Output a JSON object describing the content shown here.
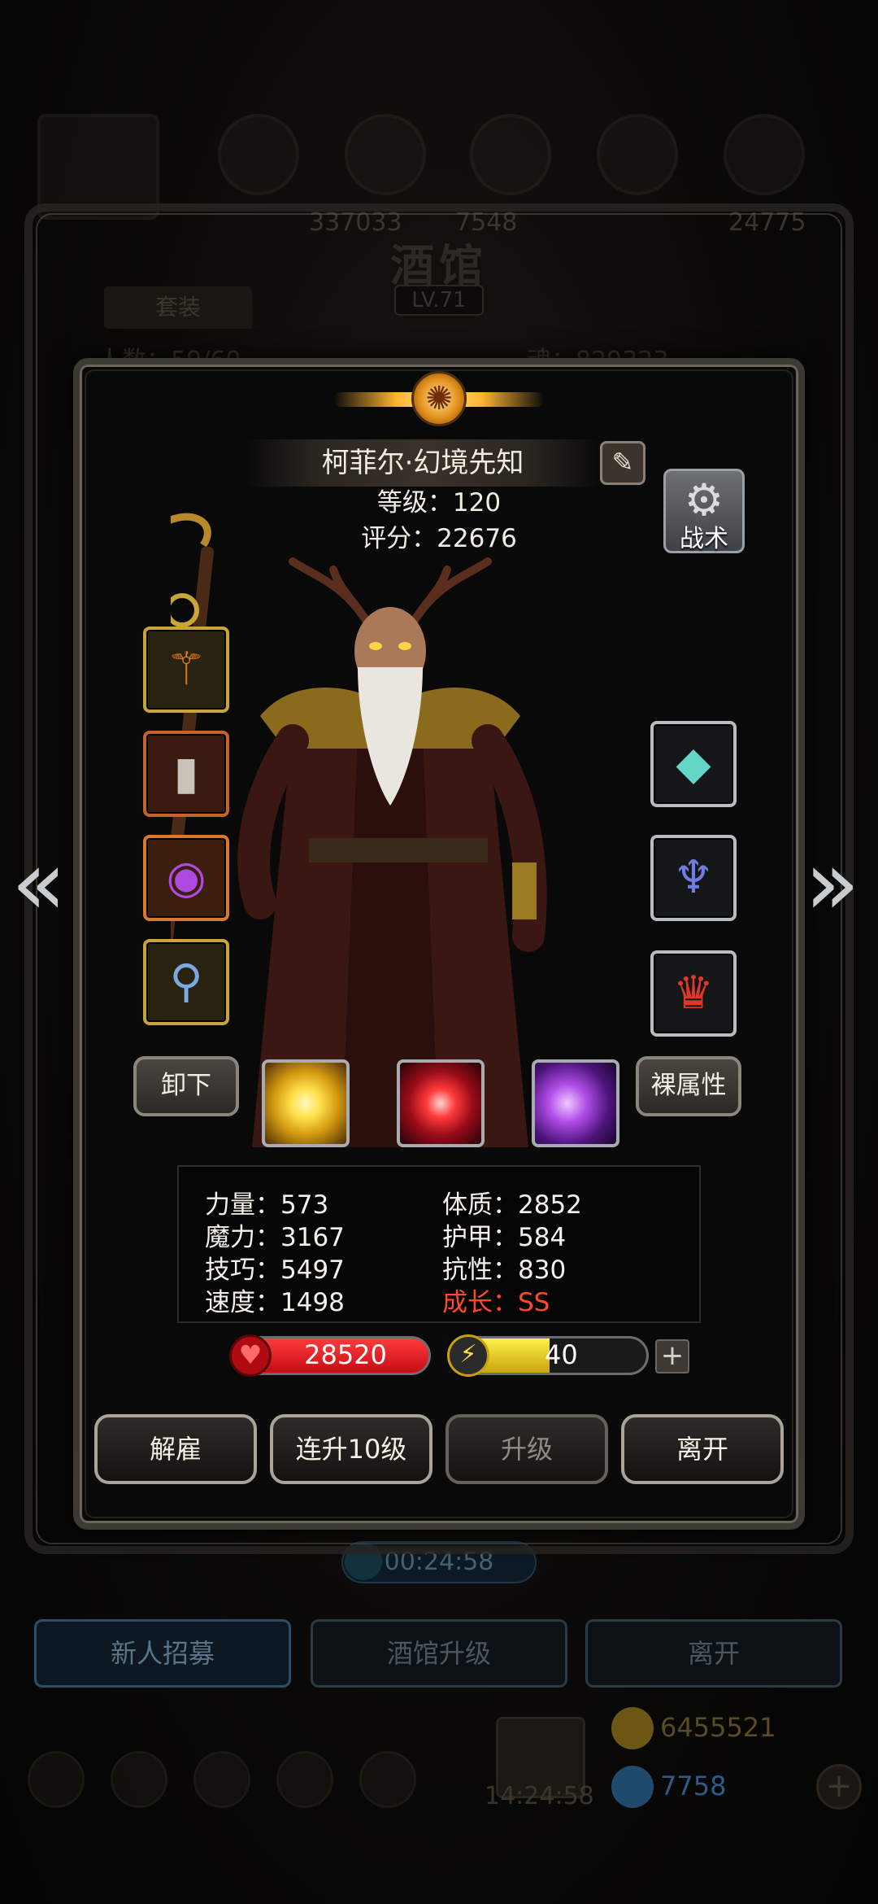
{
  "background": {
    "resource_values": [
      "337033",
      "7548",
      "24775"
    ],
    "title": "酒馆",
    "level": "LV.71",
    "tab_label": "套装",
    "capacity_text": "人数：59/60",
    "soul_text": "魂：829323",
    "timer": "00:24:58",
    "bottom_buttons": [
      "新人招募",
      "酒馆升级",
      "离开"
    ],
    "gift_timer": "14:24:58",
    "gold": "6455521",
    "gems": "7758"
  },
  "hero": {
    "name": "柯菲尔·幻境先知",
    "level_text": "等级：120",
    "score_text": "评分：22676",
    "tactics_label": "战术",
    "edit_icon": "pencil-icon",
    "equipment_left": [
      "staff-icon",
      "armor-icon",
      "amulet-icon",
      "necklace-icon"
    ],
    "equipment_right": [
      "crystal-icon",
      "pendant-icon",
      "crest-icon"
    ],
    "unequip_label": "卸下",
    "bare_attr_label": "裸属性",
    "skills": [
      "light-burst-skill",
      "red-slash-skill",
      "shadow-claw-skill"
    ]
  },
  "stats": {
    "strength": "力量：573",
    "magic": "魔力：3167",
    "skill": "技巧：5497",
    "speed": "速度：1498",
    "constitution": "体质：2852",
    "armor": "护甲：584",
    "resistance": "抗性：830",
    "growth": "成长：SS"
  },
  "bars": {
    "hp_value": "28520",
    "energy_value": "40",
    "energy_fraction": 0.5,
    "plus_label": "+"
  },
  "actions": {
    "dismiss": "解雇",
    "upgrade10": "连升10级",
    "upgrade": "升级",
    "leave": "离开"
  },
  "colors": {
    "growth": "#ff4a2a",
    "hp": "#c50d14",
    "energy": "#ffe23a"
  }
}
